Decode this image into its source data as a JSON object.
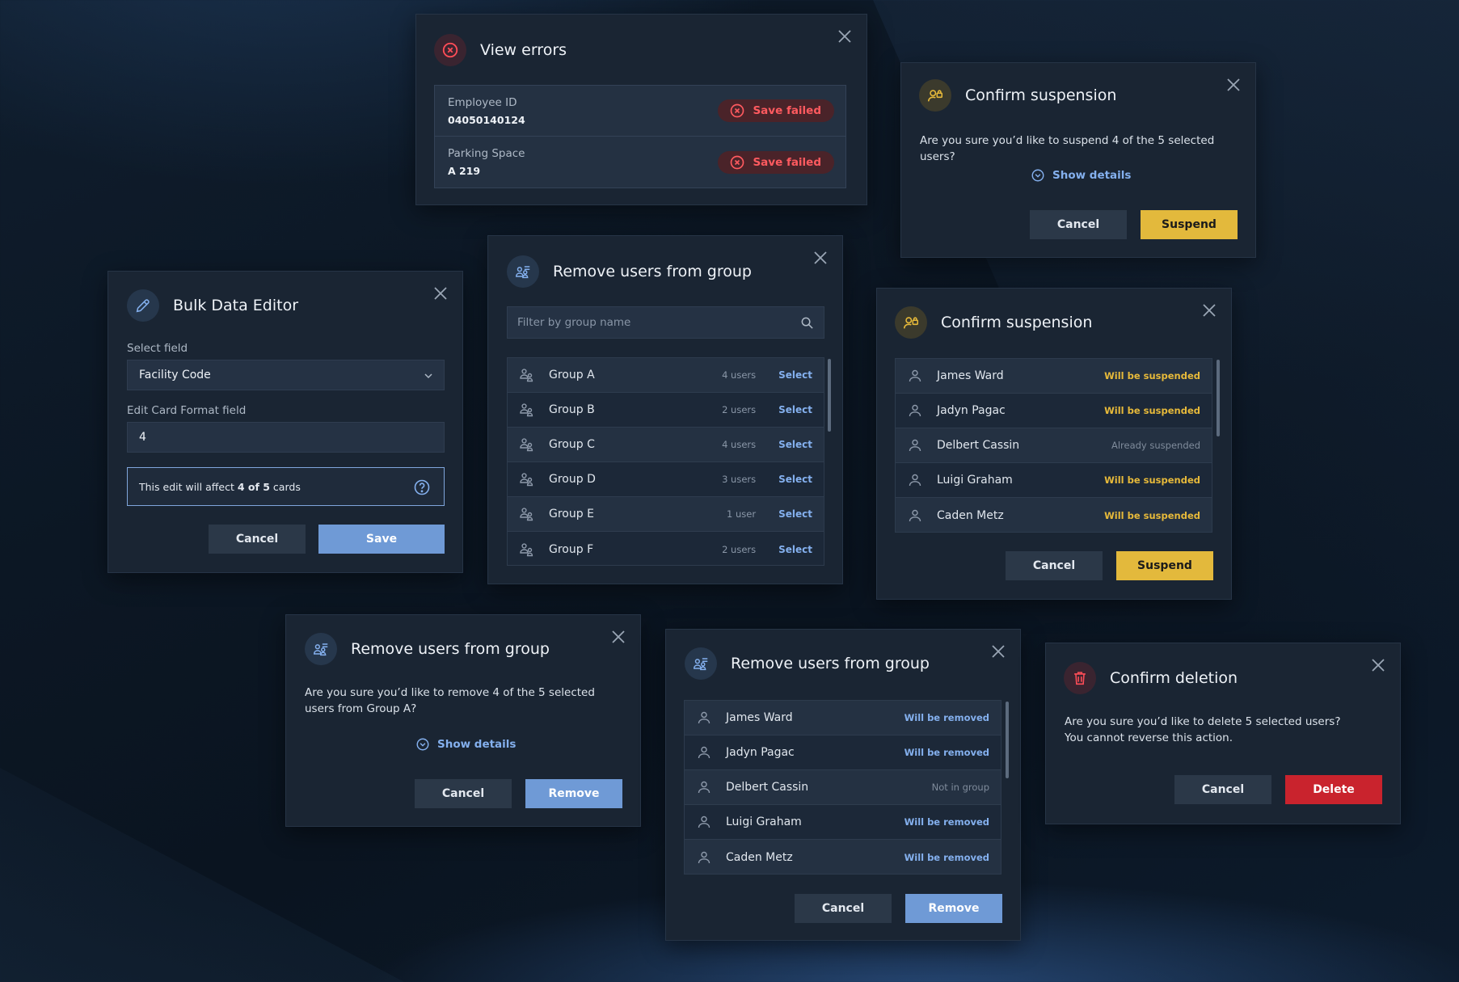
{
  "colors": {
    "accent_blue": "#6f9ad6",
    "link_blue": "#84b0ee",
    "warning_gold": "#e3b93c",
    "danger_red": "#c9232d",
    "dialog_bg": "#1a2533"
  },
  "view_errors": {
    "title": "View errors",
    "rows": [
      {
        "label": "Employee ID",
        "value": "04050140124",
        "status": "Save failed"
      },
      {
        "label": "Parking Space",
        "value": "A 219",
        "status": "Save failed"
      }
    ]
  },
  "suspend_simple": {
    "title": "Confirm suspension",
    "message": "Are you sure you’d like to suspend 4 of the 5 selected users?",
    "details_label": "Show details",
    "cancel_label": "Cancel",
    "confirm_label": "Suspend"
  },
  "bulk_editor": {
    "title": "Bulk Data Editor",
    "select_label": "Select field",
    "select_value": "Facility Code",
    "edit_label": "Edit Card Format field",
    "edit_value": "4",
    "info_prefix": "This edit will affect ",
    "info_bold": "4 of 5",
    "info_suffix": " cards",
    "cancel_label": "Cancel",
    "save_label": "Save"
  },
  "remove_group_list": {
    "title": "Remove users from group",
    "search_placeholder": "Filter by group name",
    "select_label": "Select",
    "groups": [
      {
        "name": "Group A",
        "count": "4 users"
      },
      {
        "name": "Group B",
        "count": "2 users"
      },
      {
        "name": "Group C",
        "count": "4 users"
      },
      {
        "name": "Group D",
        "count": "3 users"
      },
      {
        "name": "Group E",
        "count": "1 user"
      },
      {
        "name": "Group F",
        "count": "2 users"
      }
    ]
  },
  "suspend_detail": {
    "title": "Confirm suspension",
    "users": [
      {
        "name": "James Ward",
        "status": "Will be suspended",
        "kind": "gold"
      },
      {
        "name": "Jadyn Pagac",
        "status": "Will be suspended",
        "kind": "gold"
      },
      {
        "name": "Delbert Cassin",
        "status": "Already suspended",
        "kind": "gray"
      },
      {
        "name": "Luigi Graham",
        "status": "Will be suspended",
        "kind": "gold"
      },
      {
        "name": "Caden Metz",
        "status": "Will be suspended",
        "kind": "gold"
      }
    ],
    "cancel_label": "Cancel",
    "confirm_label": "Suspend"
  },
  "remove_simple": {
    "title": "Remove users from group",
    "message": "Are you sure you’d like to remove 4 of the 5 selected users from Group A?",
    "details_label": "Show details",
    "cancel_label": "Cancel",
    "confirm_label": "Remove"
  },
  "remove_detail": {
    "title": "Remove users from group",
    "users": [
      {
        "name": "James Ward",
        "status": "Will be removed",
        "kind": "blue"
      },
      {
        "name": "Jadyn Pagac",
        "status": "Will be removed",
        "kind": "blue"
      },
      {
        "name": "Delbert Cassin",
        "status": "Not in group",
        "kind": "gray"
      },
      {
        "name": "Luigi Graham",
        "status": "Will be removed",
        "kind": "blue"
      },
      {
        "name": "Caden Metz",
        "status": "Will be removed",
        "kind": "blue"
      }
    ],
    "cancel_label": "Cancel",
    "confirm_label": "Remove"
  },
  "delete_confirm": {
    "title": "Confirm deletion",
    "message_line1": "Are you sure you’d like to delete 5 selected users?",
    "message_line2": "You cannot reverse this action.",
    "cancel_label": "Cancel",
    "confirm_label": "Delete"
  }
}
